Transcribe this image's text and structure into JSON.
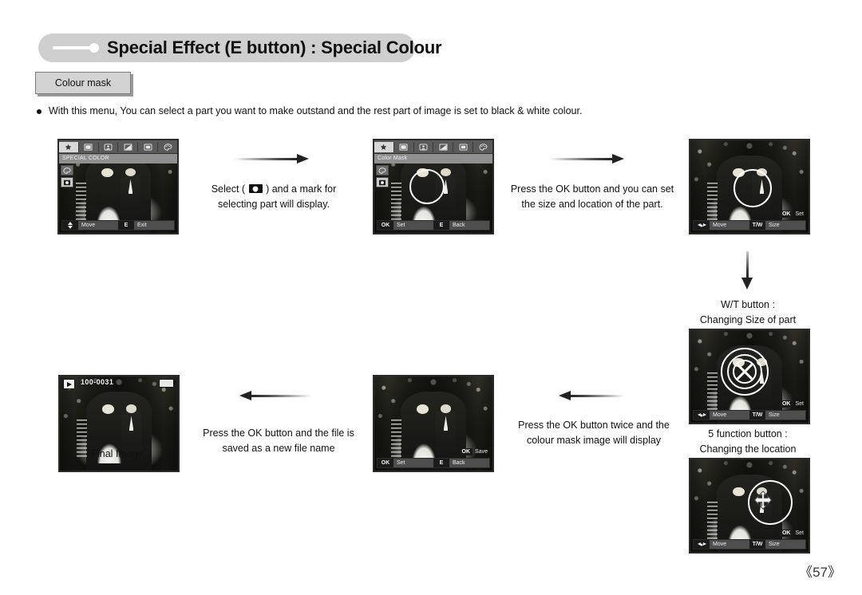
{
  "header": {
    "title": "Special Effect (E button) : Special Colour",
    "tab_label": "Colour mask"
  },
  "intro": {
    "bullet": "With this menu, You can select a part you want to make outstand and the rest part of image is set to black & white colour."
  },
  "captions": {
    "select_mark_line1": "Select (",
    "select_mark_line1b": ") and a mark for",
    "select_mark_line2": "selecting part will display.",
    "ok_set_size_line1": "Press the OK button and you can set",
    "ok_set_size_line2": "the size and location of the part.",
    "wt_button_line1": "W/T button :",
    "wt_button_line2": "Changing Size of part",
    "five_function_line1": "5 function button :",
    "five_function_line2": "Changing the location",
    "ok_twice_line1": "Press the OK button twice and the",
    "ok_twice_line2": "colour mask image will display",
    "ok_save_line1": "Press the OK button and the file is",
    "ok_save_line2": "saved as a new file name",
    "final_image": "Final Image"
  },
  "screens": {
    "menu_special_color": {
      "menu_title": "SPECIAL COLOR",
      "menu_icons": [
        "star-icon",
        "film-icon",
        "portrait-icon",
        "exposure-icon",
        "frame-icon",
        "palette-icon"
      ],
      "side_icons": [
        "palette-icon",
        "colour-mask-icon"
      ],
      "bottom": [
        {
          "key": "updown-arrow-icon",
          "label": "Move"
        },
        {
          "key": "E",
          "label": "Exit"
        }
      ]
    },
    "menu_colour_mask": {
      "menu_title": "Color Mask",
      "bottom": [
        {
          "key": "OK",
          "label": "Set"
        },
        {
          "key": "E",
          "label": "Back"
        }
      ]
    },
    "size_location": {
      "overlay_key": "OK",
      "overlay_label": "Set",
      "bottom": [
        {
          "key": "4way-arrow-icon",
          "label": "Move"
        },
        {
          "key": "T/W",
          "label": "Size"
        }
      ]
    },
    "resize": {
      "overlay_key": "OK",
      "overlay_label": "Set",
      "bottom": [
        {
          "key": "4way-arrow-icon",
          "label": "Move"
        },
        {
          "key": "T/W",
          "label": "Size"
        }
      ]
    },
    "relocate": {
      "overlay_key": "OK",
      "overlay_label": "Set",
      "bottom": [
        {
          "key": "4way-arrow-icon",
          "label": "Move"
        },
        {
          "key": "T/W",
          "label": "Size"
        }
      ]
    },
    "save": {
      "overlay_key": "OK",
      "overlay_label": "Save",
      "bottom": [
        {
          "key": "OK",
          "label": "Set"
        },
        {
          "key": "E",
          "label": "Back"
        }
      ]
    },
    "final": {
      "file_number": "100-0031",
      "playback_icon": "playback-icon",
      "battery_icon": "battery-icon"
    }
  },
  "footer": {
    "page_number": "《57》"
  },
  "colors": {
    "pill_bg": "#cfcfcf",
    "tab_bg": "#d3d3d3",
    "text": "#111111",
    "arrow": "#222222",
    "lcd_border": "#2b2b2b"
  }
}
